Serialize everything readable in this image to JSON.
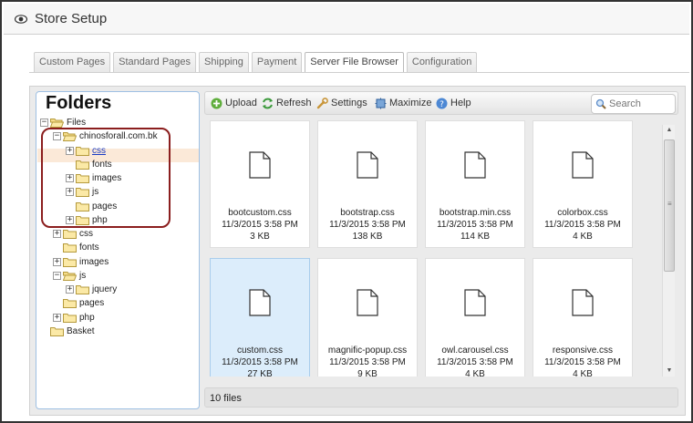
{
  "header": {
    "title": "Store Setup",
    "icon": "eye-icon"
  },
  "tabs": [
    {
      "label": "Custom Pages",
      "active": false
    },
    {
      "label": "Standard Pages",
      "active": false
    },
    {
      "label": "Shipping",
      "active": false
    },
    {
      "label": "Payment",
      "active": false
    },
    {
      "label": "Server File Browser",
      "active": true
    },
    {
      "label": "Configuration",
      "active": false
    }
  ],
  "folders": {
    "heading": "Folders",
    "tree": [
      {
        "label": "Files",
        "toggle": "−",
        "depth": 0
      },
      {
        "label": "chinosforall.com.bk",
        "toggle": "−",
        "depth": 1
      },
      {
        "label": "css",
        "toggle": "+",
        "depth": 2,
        "selected": true
      },
      {
        "label": "fonts",
        "toggle": "",
        "depth": 2
      },
      {
        "label": "images",
        "toggle": "+",
        "depth": 2
      },
      {
        "label": "js",
        "toggle": "+",
        "depth": 2
      },
      {
        "label": "pages",
        "toggle": "",
        "depth": 2
      },
      {
        "label": "php",
        "toggle": "+",
        "depth": 2
      },
      {
        "label": "css",
        "toggle": "+",
        "depth": 1
      },
      {
        "label": "fonts",
        "toggle": "",
        "depth": 1
      },
      {
        "label": "images",
        "toggle": "+",
        "depth": 1
      },
      {
        "label": "js",
        "toggle": "−",
        "depth": 1
      },
      {
        "label": "jquery",
        "toggle": "+",
        "depth": 2
      },
      {
        "label": "pages",
        "toggle": "",
        "depth": 1
      },
      {
        "label": "php",
        "toggle": "+",
        "depth": 1
      },
      {
        "label": "Basket",
        "toggle": "",
        "depth": 0
      }
    ]
  },
  "toolbar": {
    "upload": "Upload",
    "refresh": "Refresh",
    "settings": "Settings",
    "maximize": "Maximize",
    "help": "Help",
    "search_placeholder": "Search"
  },
  "files": [
    {
      "name": "bootcustom.css",
      "date": "11/3/2015 3:58 PM",
      "size": "3 KB"
    },
    {
      "name": "bootstrap.css",
      "date": "11/3/2015 3:58 PM",
      "size": "138 KB"
    },
    {
      "name": "bootstrap.min.css",
      "date": "11/3/2015 3:58 PM",
      "size": "114 KB"
    },
    {
      "name": "colorbox.css",
      "date": "11/3/2015 3:58 PM",
      "size": "4 KB"
    },
    {
      "name": "custom.css",
      "date": "11/3/2015 3:58 PM",
      "size": "27 KB",
      "selected": true
    },
    {
      "name": "magnific-popup.css",
      "date": "11/3/2015 3:58 PM",
      "size": "9 KB"
    },
    {
      "name": "owl.carousel.css",
      "date": "11/3/2015 3:58 PM",
      "size": "4 KB"
    },
    {
      "name": "responsive.css",
      "date": "11/3/2015 3:58 PM",
      "size": "4 KB"
    }
  ],
  "status": {
    "file_count": "10 files"
  },
  "colors": {
    "annotation": "#8b1e1e",
    "selected_file": "#dcedfb",
    "selected_folder": "#fbe9d8",
    "link": "#1a3cc4"
  }
}
